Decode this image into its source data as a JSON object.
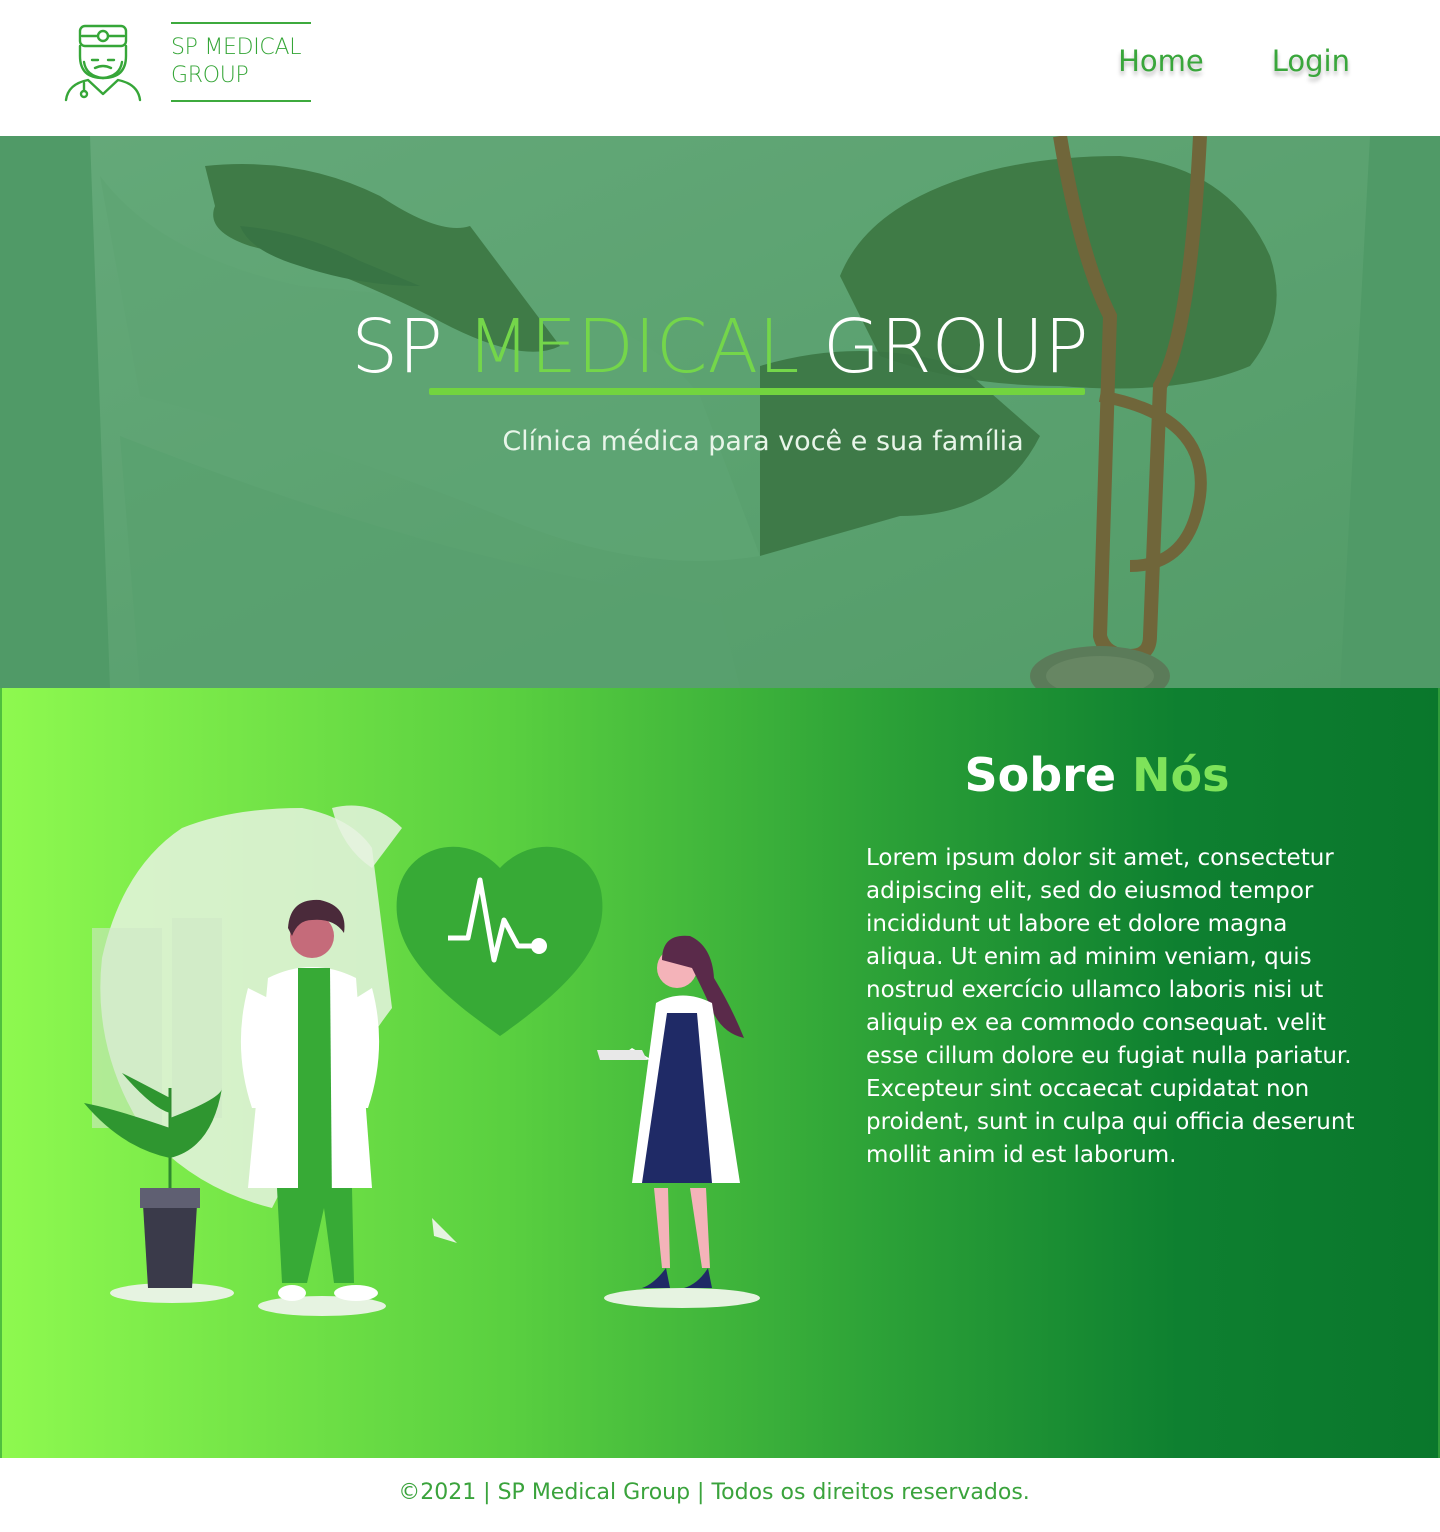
{
  "header": {
    "logo_line1": "SP MEDICAL",
    "logo_line2": "GROUP",
    "logo_icon": "doctor-icon",
    "nav": [
      {
        "label": "Home"
      },
      {
        "label": "Login"
      }
    ]
  },
  "hero": {
    "title_part1": "SP ",
    "title_accent": "MEDICAL",
    "title_part2": " GROUP",
    "subtitle": "Clínica médica para você e sua família",
    "background": "doctor-with-stethoscope-photo"
  },
  "about": {
    "title_part1": "Sobre ",
    "title_accent": "Nós",
    "body": "Lorem ipsum dolor sit amet, consectetur adipiscing elit, sed do eiusmod tempor incididunt ut labore et dolore magna aliqua. Ut enim ad minim veniam, quis nostrud exercício ullamco laboris nisi ut aliquip ex ea commodo consequat. velit esse cillum dolore eu fugiat nulla pariatur. Excepteur sint occaecat cupidatat non proident, sunt in culpa qui officia deserunt mollit anim id est laborum.",
    "illustration": "doctors-illustration"
  },
  "footer": {
    "text": "©2021 | SP Medical Group | Todos os direitos reservados."
  },
  "colors": {
    "brand_green": "#36a638",
    "accent_green": "#74d64a",
    "hero_overlay": "#5e9e72",
    "dark_green": "#0a772c"
  }
}
